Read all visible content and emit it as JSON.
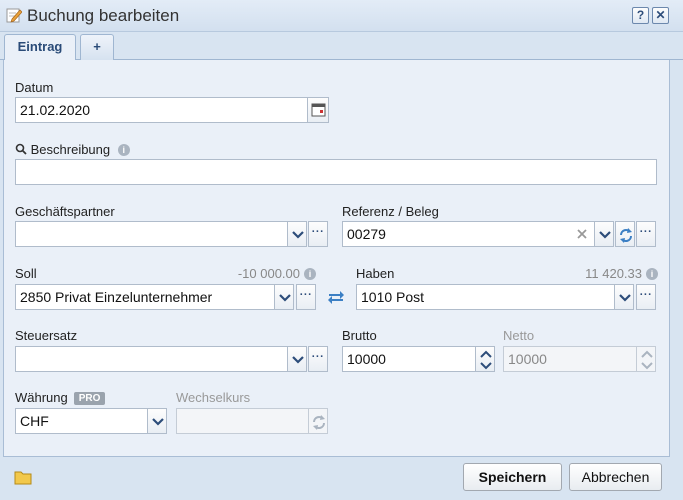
{
  "window": {
    "title": "Buchung bearbeiten",
    "help_label": "?",
    "close_label": "✕"
  },
  "tabs": [
    {
      "label": "Eintrag",
      "active": true
    },
    {
      "label": "+",
      "active": false
    }
  ],
  "form": {
    "datum": {
      "label": "Datum",
      "value": "21.02.2020"
    },
    "beschreibung": {
      "label": "Beschreibung",
      "value": ""
    },
    "geschaeftspartner": {
      "label": "Geschäftspartner",
      "value": ""
    },
    "referenz": {
      "label": "Referenz / Beleg",
      "value": "00279"
    },
    "soll": {
      "label": "Soll",
      "balance": "-10 000.00",
      "value": "2850 Privat Einzelunternehmer"
    },
    "haben": {
      "label": "Haben",
      "balance": "11 420.33",
      "value": "1010 Post"
    },
    "steuersatz": {
      "label": "Steuersatz",
      "value": ""
    },
    "brutto": {
      "label": "Brutto",
      "value": "10000"
    },
    "netto": {
      "label": "Netto",
      "value": "10000"
    },
    "waehrung": {
      "label": "Währung",
      "badge": "PRO",
      "value": "CHF"
    },
    "wechselkurs": {
      "label": "Wechselkurs",
      "value": ""
    }
  },
  "more_label": "···",
  "buttons": {
    "save": "Speichern",
    "cancel": "Abbrechen"
  },
  "colors": {
    "accent": "#2d4d7a",
    "swap_icon": "#3b7fc4"
  }
}
